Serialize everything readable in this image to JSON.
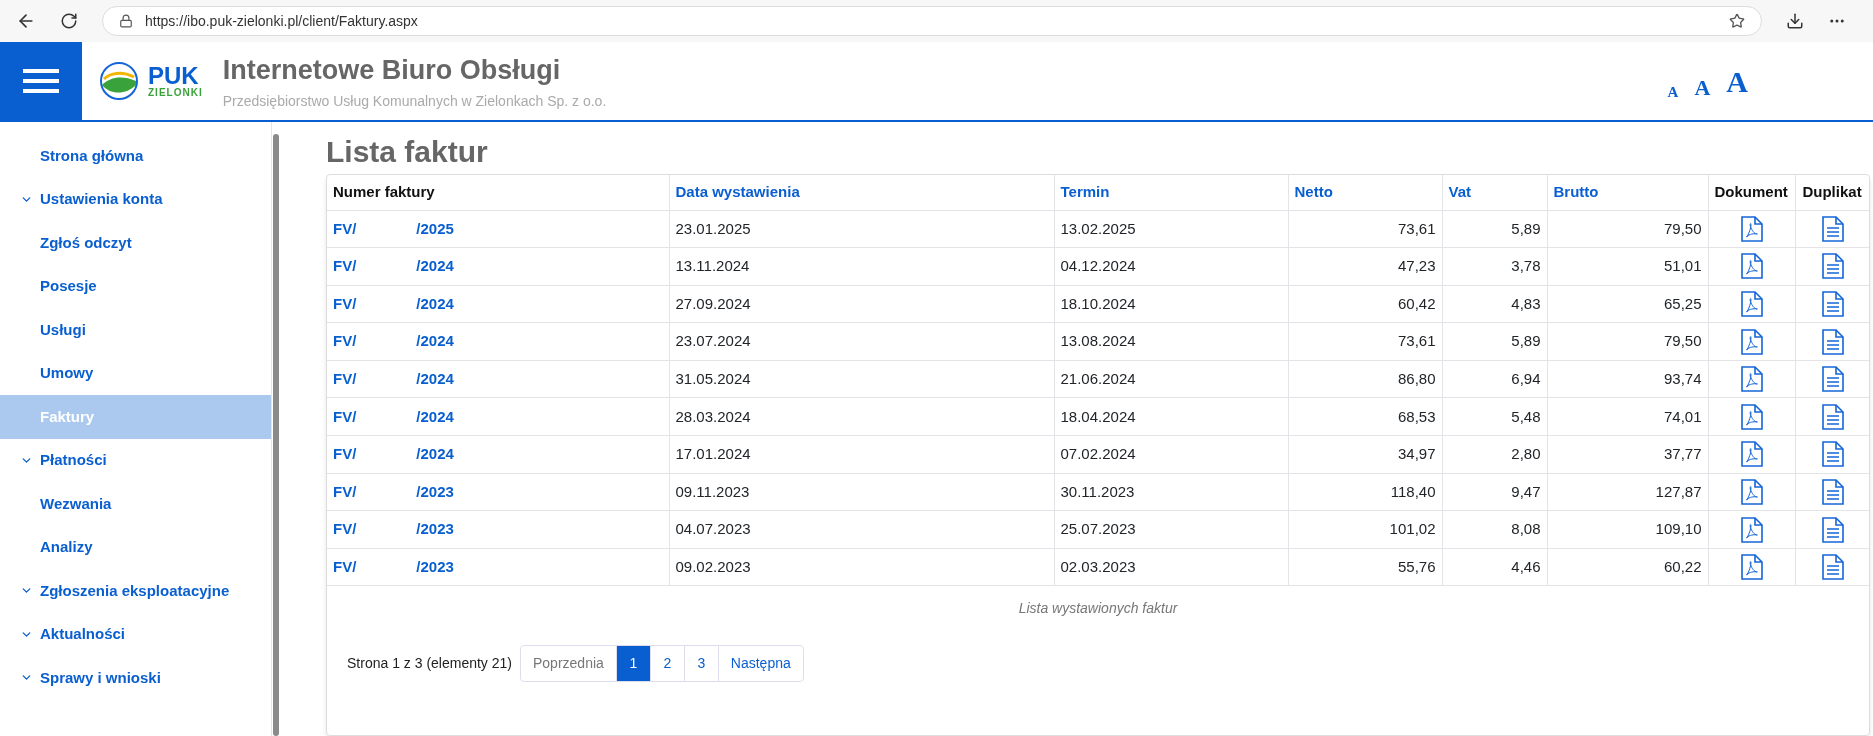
{
  "browser": {
    "url": "https://ibo.puk-zielonki.pl/client/Faktury.aspx"
  },
  "header": {
    "logo_top": "PUK",
    "logo_bottom": "ZIELONKI",
    "title": "Internetowe Biuro Obsługi",
    "subtitle": "Przedsiębiorstwo Usług Komunalnych w Zielonkach Sp. z o.o.",
    "font_sizes": [
      "A",
      "A",
      "A"
    ]
  },
  "sidebar": {
    "items": [
      {
        "label": "Strona główna",
        "expandable": false,
        "selected": false
      },
      {
        "label": "Ustawienia konta",
        "expandable": true,
        "selected": false
      },
      {
        "label": "Zgłoś odczyt",
        "expandable": false,
        "selected": false
      },
      {
        "label": "Posesje",
        "expandable": false,
        "selected": false
      },
      {
        "label": "Usługi",
        "expandable": false,
        "selected": false
      },
      {
        "label": "Umowy",
        "expandable": false,
        "selected": false
      },
      {
        "label": "Faktury",
        "expandable": false,
        "selected": true
      },
      {
        "label": "Płatności",
        "expandable": true,
        "selected": false
      },
      {
        "label": "Wezwania",
        "expandable": false,
        "selected": false
      },
      {
        "label": "Analizy",
        "expandable": false,
        "selected": false
      },
      {
        "label": "Zgłoszenia eksploatacyjne",
        "expandable": true,
        "selected": false
      },
      {
        "label": "Aktualności",
        "expandable": true,
        "selected": false
      },
      {
        "label": "Sprawy i wnioski",
        "expandable": true,
        "selected": false
      }
    ]
  },
  "page_title": "Lista faktur",
  "table": {
    "columns": [
      {
        "label": "Numer faktury",
        "sortable": false
      },
      {
        "label": "Data wystawienia",
        "sortable": true
      },
      {
        "label": "Termin",
        "sortable": true
      },
      {
        "label": "Netto",
        "sortable": true
      },
      {
        "label": "Vat",
        "sortable": true
      },
      {
        "label": "Brutto",
        "sortable": true
      },
      {
        "label": "Dokument",
        "sortable": false
      },
      {
        "label": "Duplikat",
        "sortable": false
      }
    ],
    "rows": [
      {
        "number_start": "FV/",
        "number_end": "/2025",
        "issued": "23.01.2025",
        "due": "13.02.2025",
        "net": "73,61",
        "vat": "5,89",
        "gross": "79,50"
      },
      {
        "number_start": "FV/",
        "number_end": "/2024",
        "issued": "13.11.2024",
        "due": "04.12.2024",
        "net": "47,23",
        "vat": "3,78",
        "gross": "51,01"
      },
      {
        "number_start": "FV/",
        "number_end": "/2024",
        "issued": "27.09.2024",
        "due": "18.10.2024",
        "net": "60,42",
        "vat": "4,83",
        "gross": "65,25"
      },
      {
        "number_start": "FV/",
        "number_end": "/2024",
        "issued": "23.07.2024",
        "due": "13.08.2024",
        "net": "73,61",
        "vat": "5,89",
        "gross": "79,50"
      },
      {
        "number_start": "FV/",
        "number_end": "/2024",
        "issued": "31.05.2024",
        "due": "21.06.2024",
        "net": "86,80",
        "vat": "6,94",
        "gross": "93,74"
      },
      {
        "number_start": "FV/",
        "number_end": "/2024",
        "issued": "28.03.2024",
        "due": "18.04.2024",
        "net": "68,53",
        "vat": "5,48",
        "gross": "74,01"
      },
      {
        "number_start": "FV/",
        "number_end": "/2024",
        "issued": "17.01.2024",
        "due": "07.02.2024",
        "net": "34,97",
        "vat": "2,80",
        "gross": "37,77"
      },
      {
        "number_start": "FV/",
        "number_end": "/2023",
        "issued": "09.11.2023",
        "due": "30.11.2023",
        "net": "118,40",
        "vat": "9,47",
        "gross": "127,87"
      },
      {
        "number_start": "FV/",
        "number_end": "/2023",
        "issued": "04.07.2023",
        "due": "25.07.2023",
        "net": "101,02",
        "vat": "8,08",
        "gross": "109,10"
      },
      {
        "number_start": "FV/",
        "number_end": "/2023",
        "issued": "09.02.2023",
        "due": "02.03.2023",
        "net": "55,76",
        "vat": "4,46",
        "gross": "60,22"
      }
    ],
    "caption": "Lista wystawionych faktur"
  },
  "pagination": {
    "summary": "Strona 1 z 3 (elementy 21)",
    "previous": "Poprzednia",
    "pages": [
      {
        "label": "1",
        "selected": true
      },
      {
        "label": "2",
        "selected": false
      },
      {
        "label": "3",
        "selected": false
      }
    ],
    "next": "Następna"
  }
}
